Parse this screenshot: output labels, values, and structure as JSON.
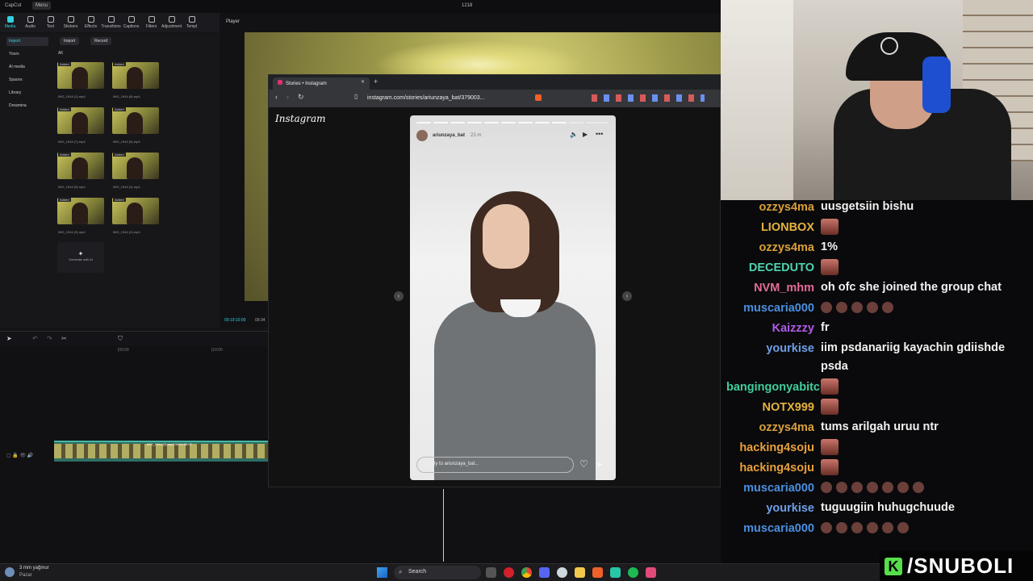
{
  "capcut": {
    "app_name": "CapCut",
    "menu_label": "Menu",
    "window_title": "1218",
    "toolbar": [
      {
        "label": "Media",
        "icon": "media-icon"
      },
      {
        "label": "Audio",
        "icon": "audio-icon"
      },
      {
        "label": "Text",
        "icon": "text-icon"
      },
      {
        "label": "Stickers",
        "icon": "stickers-icon"
      },
      {
        "label": "Effects",
        "icon": "effects-icon"
      },
      {
        "label": "Transitions",
        "icon": "transitions-icon"
      },
      {
        "label": "Captions",
        "icon": "captions-icon"
      },
      {
        "label": "Filters",
        "icon": "filters-icon"
      },
      {
        "label": "Adjustment",
        "icon": "adjustment-icon"
      },
      {
        "label": "Templ",
        "icon": "templates-icon"
      }
    ],
    "sidebar": [
      "Import",
      "Yours",
      "AI media",
      "Spaces",
      "Library",
      "Dreamina"
    ],
    "import_button": "Import",
    "record_button": "Record",
    "filter_all": "All",
    "media_items": [
      {
        "tag": "Added",
        "name": "IMG_1944 (1).mp4"
      },
      {
        "tag": "Added",
        "name": "IMG_1944 (8).mp4"
      },
      {
        "tag": "Added",
        "name": "IMG_1944 (7).mp4"
      },
      {
        "tag": "Added",
        "name": "IMG_1944 (6).mp4"
      },
      {
        "tag": "Added",
        "name": "IMG_1944 (5).mp4"
      },
      {
        "tag": "Added",
        "name": "IMG_1944 (4).mp4"
      },
      {
        "tag": "Added",
        "name": "IMG_1944 (3).mp4"
      },
      {
        "tag": "Added",
        "name": "IMG_1944 (2).mp4"
      }
    ],
    "generate_label": "Generate with AI",
    "player_label": "Player",
    "player_time": "00:19:10:00",
    "player_time_total": "00:34",
    "modify_button": "Modify",
    "ruler_marks": [
      "|00:00",
      "|10:00"
    ],
    "clip_left_label": "IMG_1944 (3).mp4   00:04:38:07",
    "clip_right_a_label": "IMG_1944 (7).mp4   00:04:43:27",
    "clip_right_b_label": "IMG_1944 (6).mp4   00:03:59:27"
  },
  "browser": {
    "tab_title": "Stories • Instagram",
    "url": "instagram.com/stories/ariunzaya_bat/379003...",
    "ig_logo": "Instagram",
    "story_user": "ariunzaya_bat",
    "story_age": "23 m",
    "reply_placeholder": "Reply to ariunzaya_bat..."
  },
  "chat": [
    {
      "user": "ozzys4ma",
      "color": "#d9a03a",
      "msg": "uusgetsiin bishu",
      "emotes": 0
    },
    {
      "user": "LIONBOX",
      "color": "#e6b23f",
      "msg": "",
      "emotes": 1,
      "big": true
    },
    {
      "user": "ozzys4ma",
      "color": "#d9a03a",
      "msg": "1%",
      "emotes": 0
    },
    {
      "user": "DECEDUTO",
      "color": "#4fd3b0",
      "msg": "",
      "emotes": 1,
      "big": true
    },
    {
      "user": "NVM_mhm",
      "color": "#e46a9a",
      "msg": "oh ofc she joined the group chat",
      "emotes": 0
    },
    {
      "user": "muscaria000",
      "color": "#4a8fe0",
      "msg": "",
      "emotes": 5
    },
    {
      "user": "Kaizzzy",
      "color": "#b05be6",
      "msg": "fr",
      "emotes": 0
    },
    {
      "user": "yourkise",
      "color": "#6e9fe8",
      "msg": "iim psdanariig kayachin gdiishde psda",
      "emotes": 0
    },
    {
      "user": "bangingonyabitchsa...",
      "color": "#3fcf9a",
      "msg": "",
      "emotes": 1,
      "big": true
    },
    {
      "user": "NOTX999",
      "color": "#e6b23f",
      "msg": "",
      "emotes": 1,
      "big": true
    },
    {
      "user": "ozzys4ma",
      "color": "#d9a03a",
      "msg": "tums arilgah uruu ntr",
      "emotes": 0
    },
    {
      "user": "hacking4soju",
      "color": "#e8a03a",
      "msg": "",
      "emotes": 1,
      "big": true
    },
    {
      "user": "hacking4soju",
      "color": "#e8a03a",
      "msg": "",
      "emotes": 1,
      "big": true
    },
    {
      "user": "muscaria000",
      "color": "#4a8fe0",
      "msg": "",
      "emotes": 7
    },
    {
      "user": "yourkise",
      "color": "#6e9fe8",
      "msg": "tuguugiin huhugchuude",
      "emotes": 0
    },
    {
      "user": "muscaria000",
      "color": "#4a8fe0",
      "msg": "",
      "emotes": 6
    }
  ],
  "taskbar": {
    "weather_temp": "3 mm yağmur",
    "weather_day": "Pazar",
    "search_label": "Search"
  },
  "brand": {
    "icon_letter": "K",
    "handle": "/SNUBOLI"
  }
}
